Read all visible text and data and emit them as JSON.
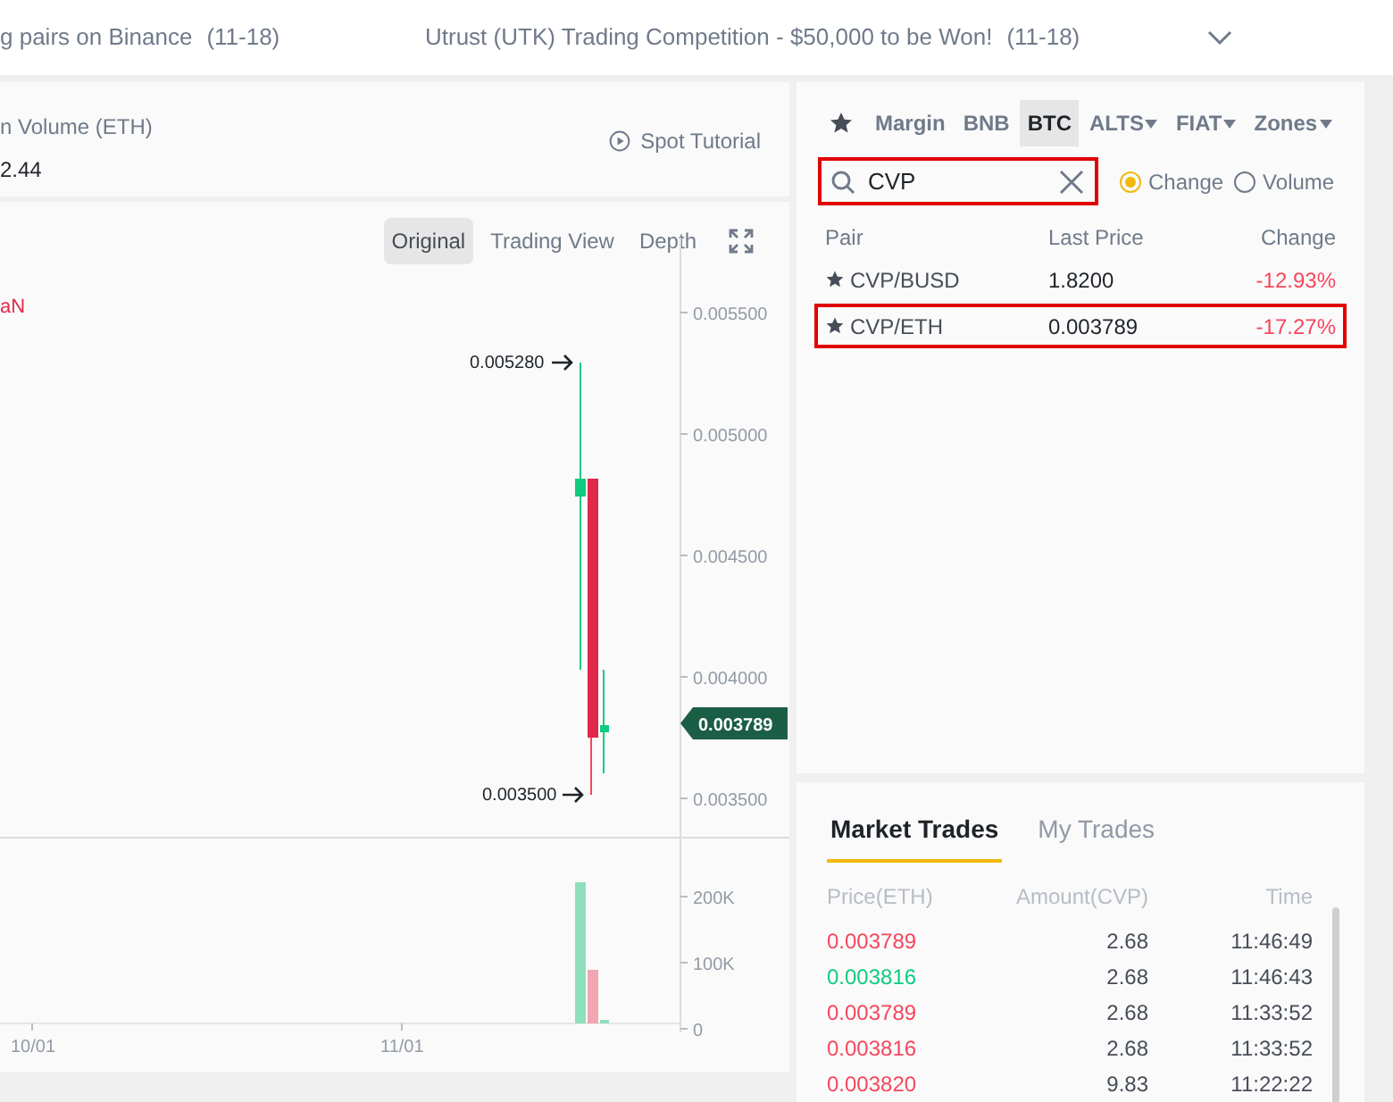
{
  "announcements": [
    {
      "text": "g pairs on Binance",
      "date": "(11-18)"
    },
    {
      "text": "Utrust (UTK) Trading Competition - $50,000 to be Won!",
      "date": "(11-18)"
    }
  ],
  "stats": {
    "label": "n Volume (ETH)",
    "value": "2.44"
  },
  "spot_tutorial": "Spot Tutorial",
  "chart_tabs": [
    {
      "label": "Original",
      "selected": true
    },
    {
      "label": "Trading View",
      "selected": false
    },
    {
      "label": "Depth",
      "selected": false
    }
  ],
  "chart": {
    "legend": "aN",
    "price_axis": [
      "0.005500",
      "0.005000",
      "0.004500",
      "0.004000",
      "0.003500"
    ],
    "high_marker": "0.005280",
    "low_marker": "0.003500",
    "last_price": "0.003789",
    "volume_axis": [
      "200K",
      "100K",
      "0"
    ],
    "dates": [
      "10/01",
      "11/01"
    ]
  },
  "market_tabs": [
    {
      "label": "Margin",
      "selected": false,
      "dropdown": false
    },
    {
      "label": "BNB",
      "selected": false,
      "dropdown": false
    },
    {
      "label": "BTC",
      "selected": true,
      "dropdown": false
    },
    {
      "label": "ALTS",
      "selected": false,
      "dropdown": true
    },
    {
      "label": "FIAT",
      "selected": false,
      "dropdown": true
    },
    {
      "label": "Zones",
      "selected": false,
      "dropdown": true
    }
  ],
  "search": {
    "value": "CVP"
  },
  "sort_options": [
    {
      "label": "Change",
      "selected": true
    },
    {
      "label": "Volume",
      "selected": false
    }
  ],
  "pairs": {
    "columns": [
      "Pair",
      "Last Price",
      "Change"
    ],
    "rows": [
      {
        "pair": "CVP/BUSD",
        "price": "1.8200",
        "change": "-12.93%",
        "selected": false
      },
      {
        "pair": "CVP/ETH",
        "price": "0.003789",
        "change": "-17.27%",
        "selected": true
      }
    ]
  },
  "trade_tabs": [
    {
      "label": "Market Trades",
      "selected": true
    },
    {
      "label": "My Trades",
      "selected": false
    }
  ],
  "trades": {
    "columns": [
      "Price(ETH)",
      "Amount(CVP)",
      "Time"
    ],
    "rows": [
      {
        "price": "0.003789",
        "amount": "2.68",
        "time": "11:46:49",
        "color": "#f6465d"
      },
      {
        "price": "0.003816",
        "amount": "2.68",
        "time": "11:46:43",
        "color": "#0ecb81"
      },
      {
        "price": "0.003789",
        "amount": "2.68",
        "time": "11:33:52",
        "color": "#f6465d"
      },
      {
        "price": "0.003816",
        "amount": "2.68",
        "time": "11:33:52",
        "color": "#f6465d"
      },
      {
        "price": "0.003820",
        "amount": "9.83",
        "time": "11:22:22",
        "color": "#f6465d"
      }
    ]
  }
}
